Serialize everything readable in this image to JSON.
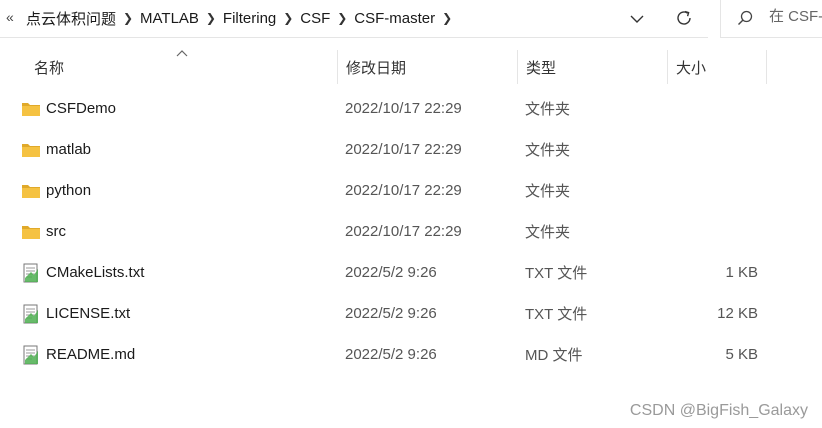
{
  "address": {
    "overflow": "«",
    "breadcrumbs": [
      "点云体积问题",
      "MATLAB",
      "Filtering",
      "CSF",
      "CSF-master"
    ]
  },
  "search": {
    "placeholder": "在 CSF-"
  },
  "columns": {
    "name": "名称",
    "date": "修改日期",
    "type": "类型",
    "size": "大小"
  },
  "files": [
    {
      "name": "CSFDemo",
      "date": "2022/10/17 22:29",
      "type": "文件夹",
      "size": "",
      "icon": "folder-icon"
    },
    {
      "name": "matlab",
      "date": "2022/10/17 22:29",
      "type": "文件夹",
      "size": "",
      "icon": "folder-icon"
    },
    {
      "name": "python",
      "date": "2022/10/17 22:29",
      "type": "文件夹",
      "size": "",
      "icon": "folder-icon"
    },
    {
      "name": "src",
      "date": "2022/10/17 22:29",
      "type": "文件夹",
      "size": "",
      "icon": "folder-icon"
    },
    {
      "name": "CMakeLists.txt",
      "date": "2022/5/2 9:26",
      "type": "TXT 文件",
      "size": "1 KB",
      "icon": "text-file-icon"
    },
    {
      "name": "LICENSE.txt",
      "date": "2022/5/2 9:26",
      "type": "TXT 文件",
      "size": "12 KB",
      "icon": "text-file-icon"
    },
    {
      "name": "README.md",
      "date": "2022/5/2 9:26",
      "type": "MD 文件",
      "size": "5 KB",
      "icon": "text-file-icon"
    }
  ],
  "watermark": "CSDN @BigFish_Galaxy",
  "colors": {
    "folder": "#f5c242",
    "folder_dark": "#e0a92a",
    "file_green": "#4caf50"
  }
}
